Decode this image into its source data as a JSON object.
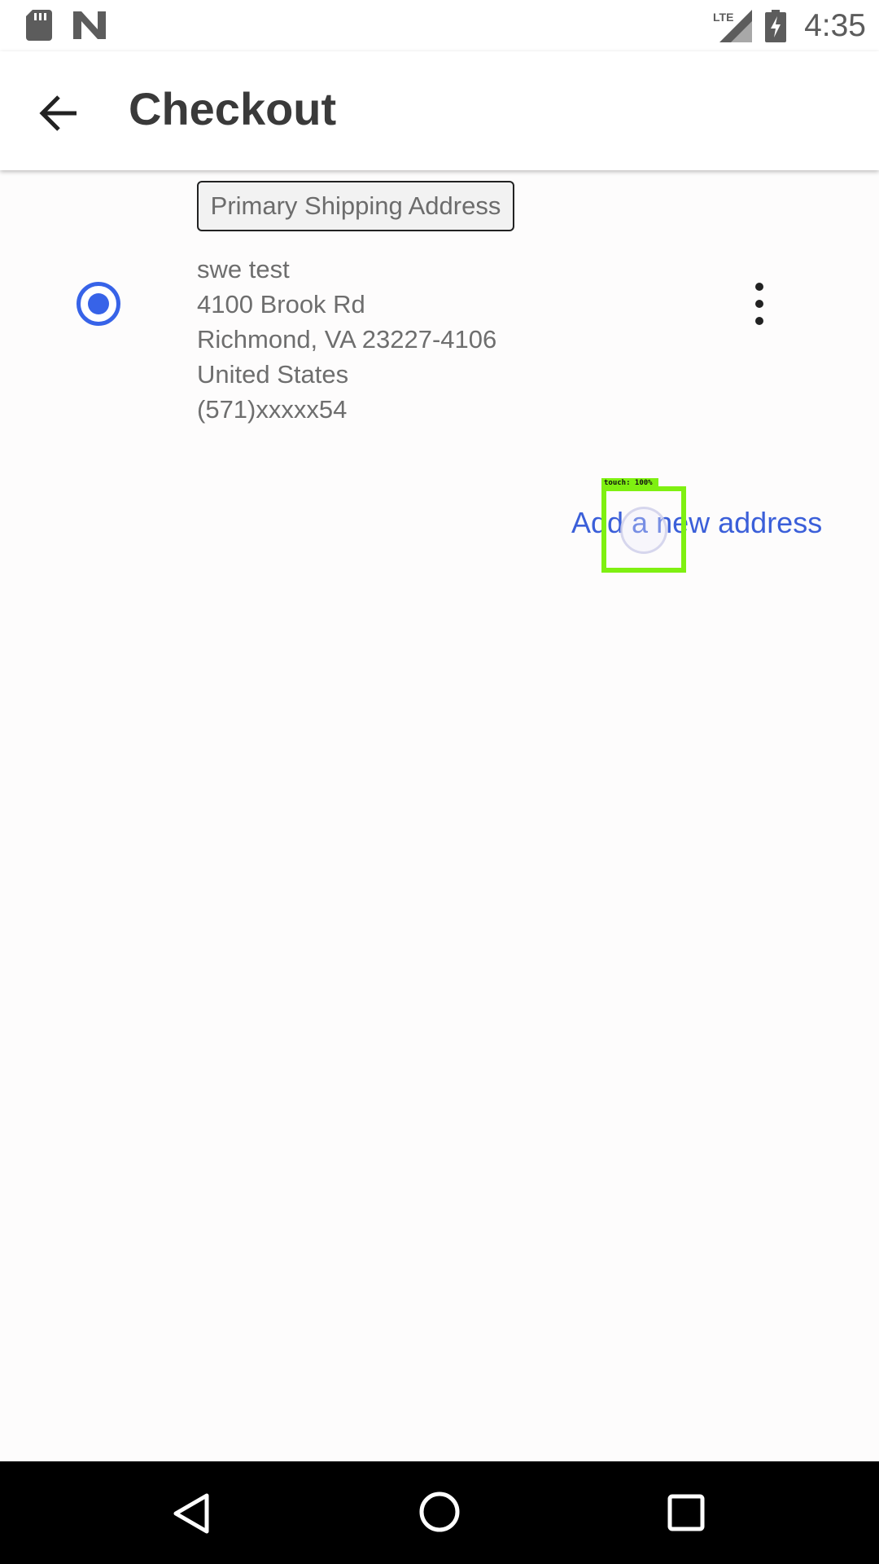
{
  "status_bar": {
    "time": "4:35",
    "network": "LTE",
    "icons": [
      "sd-card-icon",
      "n-notification-icon",
      "lte-signal-icon",
      "battery-charging-icon"
    ]
  },
  "app_bar": {
    "title": "Checkout",
    "back_icon": "arrow-left-icon"
  },
  "address": {
    "tag": "Primary Shipping Address",
    "selected": true,
    "lines": [
      "swe test",
      "4100 Brook Rd",
      "Richmond, VA 23227-4106",
      "United States",
      "(571)xxxxx54"
    ],
    "menu_icon": "more-vert-icon"
  },
  "actions": {
    "add_address": "Add a new address"
  },
  "touch_overlay": {
    "label": "touch: 100%"
  },
  "nav_bar": {
    "icons": [
      "back-triangle-icon",
      "home-circle-icon",
      "recents-square-icon"
    ]
  },
  "colors": {
    "accent": "#3763e8",
    "link": "#3b5fd9",
    "touch_highlight": "#7ff011",
    "title_text": "#3a3a3a",
    "body_text": "#6e6e6e"
  }
}
